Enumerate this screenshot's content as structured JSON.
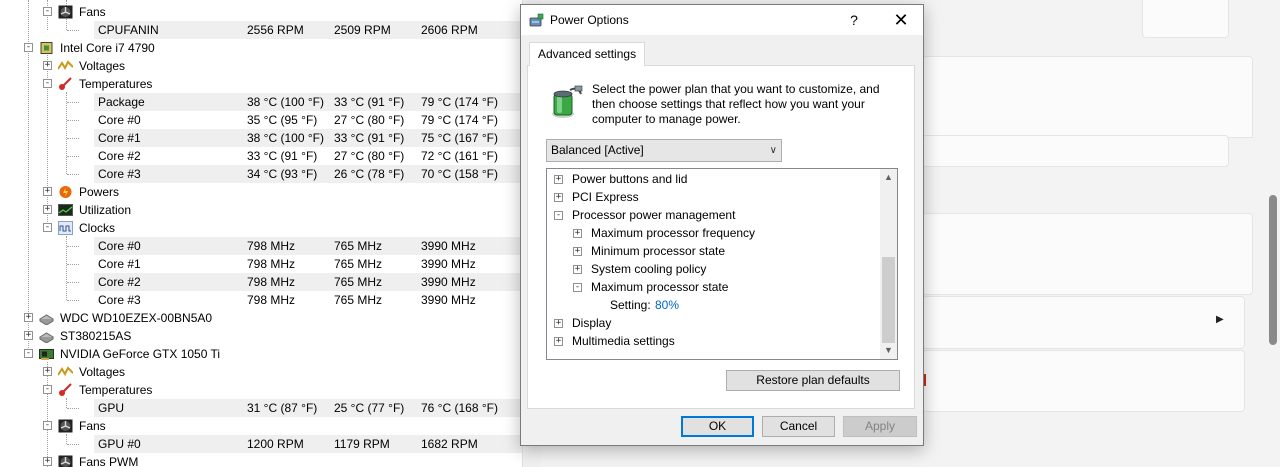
{
  "hwmon": {
    "rows": [
      {
        "label": "Fans",
        "indent": 3,
        "icon": "fan-icon",
        "toggle": "-"
      },
      {
        "label": "CPUFANIN",
        "indent": 5,
        "values": [
          "2556 RPM",
          "2509 RPM",
          "2606 RPM"
        ],
        "striped": true
      },
      {
        "label": "Intel Core i7 4790",
        "indent": 1,
        "icon": "cpu-icon",
        "toggle": "-"
      },
      {
        "label": "Voltages",
        "indent": 3,
        "icon": "voltage-icon",
        "toggle": "+"
      },
      {
        "label": "Temperatures",
        "indent": 3,
        "icon": "thermometer-icon",
        "toggle": "-"
      },
      {
        "label": "Package",
        "indent": 5,
        "values": [
          "38 °C  (100 °F)",
          "33 °C  (91 °F)",
          "79 °C  (174 °F)"
        ],
        "striped": true
      },
      {
        "label": "Core #0",
        "indent": 5,
        "values": [
          "35 °C  (95 °F)",
          "27 °C  (80 °F)",
          "79 °C  (174 °F)"
        ]
      },
      {
        "label": "Core #1",
        "indent": 5,
        "values": [
          "38 °C  (100 °F)",
          "33 °C  (91 °F)",
          "75 °C  (167 °F)"
        ],
        "striped": true
      },
      {
        "label": "Core #2",
        "indent": 5,
        "values": [
          "33 °C  (91 °F)",
          "27 °C  (80 °F)",
          "72 °C  (161 °F)"
        ]
      },
      {
        "label": "Core #3",
        "indent": 5,
        "values": [
          "34 °C  (93 °F)",
          "26 °C  (78 °F)",
          "70 °C  (158 °F)"
        ],
        "striped": true
      },
      {
        "label": "Powers",
        "indent": 3,
        "icon": "power-icon",
        "toggle": "+"
      },
      {
        "label": "Utilization",
        "indent": 3,
        "icon": "utilization-icon",
        "toggle": "+"
      },
      {
        "label": "Clocks",
        "indent": 3,
        "icon": "clock-icon",
        "toggle": "-"
      },
      {
        "label": "Core #0",
        "indent": 5,
        "values": [
          "798 MHz",
          "765 MHz",
          "3990 MHz"
        ],
        "striped": true
      },
      {
        "label": "Core #1",
        "indent": 5,
        "values": [
          "798 MHz",
          "765 MHz",
          "3990 MHz"
        ]
      },
      {
        "label": "Core #2",
        "indent": 5,
        "values": [
          "798 MHz",
          "765 MHz",
          "3990 MHz"
        ],
        "striped": true
      },
      {
        "label": "Core #3",
        "indent": 5,
        "values": [
          "798 MHz",
          "765 MHz",
          "3990 MHz"
        ]
      },
      {
        "label": "WDC WD10EZEX-00BN5A0",
        "indent": 1,
        "icon": "disk-icon",
        "toggle": "+"
      },
      {
        "label": "ST380215AS",
        "indent": 1,
        "icon": "disk-icon",
        "toggle": "+"
      },
      {
        "label": "NVIDIA GeForce GTX 1050 Ti",
        "indent": 1,
        "icon": "gpu-icon",
        "toggle": "-"
      },
      {
        "label": "Voltages",
        "indent": 3,
        "icon": "voltage-icon",
        "toggle": "+"
      },
      {
        "label": "Temperatures",
        "indent": 3,
        "icon": "thermometer-icon",
        "toggle": "-"
      },
      {
        "label": "GPU",
        "indent": 5,
        "values": [
          "31 °C  (87 °F)",
          "25 °C  (77 °F)",
          "76 °C  (168 °F)"
        ],
        "striped": true
      },
      {
        "label": "Fans",
        "indent": 3,
        "icon": "fan-icon",
        "toggle": "-"
      },
      {
        "label": "GPU #0",
        "indent": 5,
        "values": [
          "1200 RPM",
          "1179 RPM",
          "1682 RPM"
        ],
        "striped": true
      },
      {
        "label": "Fans PWM",
        "indent": 3,
        "icon": "fan-icon",
        "toggle": "+"
      }
    ]
  },
  "dialog": {
    "title": "Power Options",
    "help_label": "?",
    "close_label": "✕",
    "tab_label": "Advanced settings",
    "description": "Select the power plan that you want to customize, and then choose settings that reflect how you want your computer to manage power.",
    "plan_select": "Balanced [Active]",
    "tree": [
      {
        "label": "Power buttons and lid",
        "level": 0,
        "toggle": "+"
      },
      {
        "label": "PCI Express",
        "level": 0,
        "toggle": "+"
      },
      {
        "label": "Processor power management",
        "level": 0,
        "toggle": "-"
      },
      {
        "label": "Maximum processor frequency",
        "level": 1,
        "toggle": "+"
      },
      {
        "label": "Minimum processor state",
        "level": 1,
        "toggle": "+"
      },
      {
        "label": "System cooling policy",
        "level": 1,
        "toggle": "+"
      },
      {
        "label": "Maximum processor state",
        "level": 1,
        "toggle": "-"
      },
      {
        "label": "Setting:",
        "level": 2,
        "value": "80%"
      },
      {
        "label": "Display",
        "level": 0,
        "toggle": "+"
      },
      {
        "label": "Multimedia settings",
        "level": 0,
        "toggle": "+"
      }
    ],
    "restore_label": "Restore plan defaults",
    "ok_label": "OK",
    "cancel_label": "Cancel",
    "apply_label": "Apply"
  },
  "colors": {
    "accent": "#0078d7",
    "setting_value": "#0066cc"
  }
}
